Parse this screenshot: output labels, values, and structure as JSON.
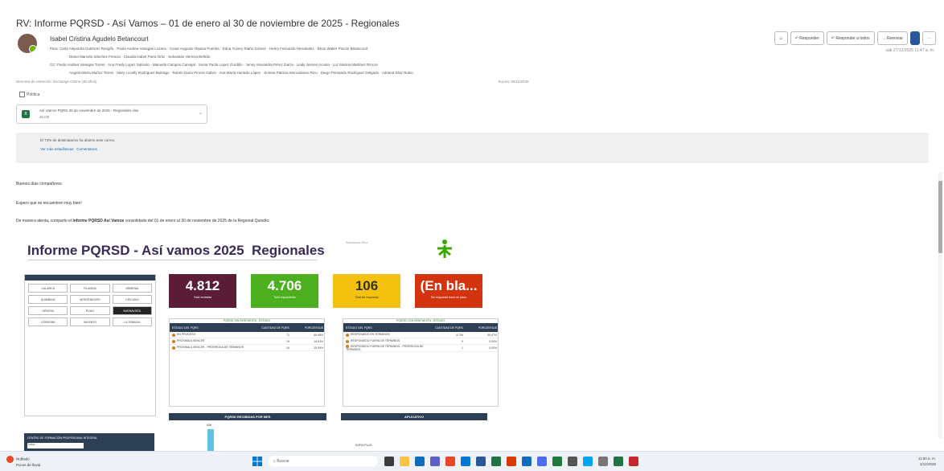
{
  "email": {
    "subject": "RV: Informe PQRSD - Así Vamos – 01 de enero al 30 de noviembre de 2025 - Regionales",
    "sender": "Isabel Cristina Agudelo Betancourt",
    "to_line1": "Para: Carla Alejandra Gutiérrez Rengifo · Paola Andrea Vanegas Lozano · Cesar Augusto Ospina Puertas · Edna Yuvery Riaño Gómez · Henry Fernando Hernández · Brian Walter Pincón Betancourt",
    "to_line2": "Diana Marcela Sánchez Frescia · Claudia Isabel Parra Ortiz · Sebastián Herrera Beltrán",
    "cc_line1": "CC: Paola Andrea Vanegas Torres · Ana Fredy Lopez Salcedo · Manuela Campos Carvajal · Sonia Paola Lopez Gordillo · Jenny Alexandra Pérez Ibarra · Leidy Jeimes Acosta · Luz Marina Martínez Rincon",
    "cc_line2": "Angela María Muñoz Torres · Mary Lucelly Rodríguez Buitrago · Rubén Darío Pinzon Galvis · Ana María Hurtado López · Jimena Patricia Moncaleano Rico · Diego Fernando Rodríguez Delgado · Adriana Díaz Rubio",
    "retention": "Directiva de retención: Exchange Online (30 años)",
    "expires": "Expira: 30/11/2035",
    "date": "sáb 27/12/2025 11:47 a. m.",
    "checkbox_label": "Política",
    "attachment_name": "Así Vamos PQRS 30 de noviembre de 2025 - Regionales.xlsx",
    "attachment_size": "35 KB",
    "info_line": "El 73% de destinatarios ha abierto este correo.",
    "info_link1": "Ver más estadísticas",
    "info_link2": "Comentarios",
    "greeting": "Buenos días compañeros.",
    "wish": "Espero que se encuentren muy bien!",
    "intro": "De manera atenta, comparto el ",
    "intro_bold": "Informe PQRSD Así Vamos",
    "intro_end": " consolidado del 01 de enero al 30 de noviembre de 2025 de la Regional Quindío."
  },
  "toolbar": {
    "emoji": "☺",
    "reply": "↶ Responder",
    "reply_all": "↶ Responder a todos",
    "forward": "→ Reenviar",
    "more": "⋯"
  },
  "report": {
    "title": "Informe PQRSD - Así vamos 2025",
    "title_b": "Regionales",
    "gray_text": "Seleccionar filtros",
    "kpis": [
      {
        "value": "4.812",
        "label": "Total recibidas",
        "color": "#5a1d35"
      },
      {
        "value": "4.706",
        "label": "Total respondidas",
        "color": "#4caf1f"
      },
      {
        "value": "106",
        "label": "Total sin respuesta",
        "color": "#f5c10f"
      },
      {
        "value": "(En bla...",
        "label": "Sin respuesta fuera de plazo",
        "color": "#d4330f"
      }
    ],
    "table1": {
      "caption": "PQRSD SIN RESPUESTA - ESTADO",
      "headers": [
        "ESTADO DEL PQRS",
        "CANTIDAD DE PQRS",
        "PORCENTAJE"
      ],
      "rows": [
        [
          "EN PROCESO",
          "71",
          "66,98%"
        ],
        [
          "PRÓXIMA A VENCER",
          "19",
          "16,51%"
        ],
        [
          "PRÓXIMA A VENCER - PRÓRROGA DE TÉRMINOS",
          "16",
          "15,09%"
        ]
      ]
    },
    "table2": {
      "caption": "PQRSD CON RESPUESTA - ESTADO",
      "headers": [
        "ESTADO DEL PQRS",
        "CANTIDAD DE PQRS",
        "PORCENTAJE"
      ],
      "rows": [
        [
          "RESPONDIDO EN TÉRMINOS",
          "4.706",
          "99,47%"
        ],
        [
          "RESPONDIDO FUERA DE TÉRMINOS",
          "9",
          "0,00%"
        ],
        [
          "RESPONDIDO FUERA DE TÉRMINOS - PRÓRROGA DE TÉRMINOS",
          "1",
          "0,00%"
        ]
      ]
    },
    "chart1_title": "PQRSD RECIBIDAS POR MES",
    "chart1_value": "526",
    "chart2_title": "APLICATIVO",
    "chart2_label": "SOFIA PLUS",
    "filter_title": "CENTRO DE FORMACIÓN PROFESIONAL INTEGRAL",
    "filter_value": "Todos",
    "filters": [
      "CALARCÁ",
      "FILANDIA",
      "ARMENIA",
      "QUIMBAYA",
      "MONTENEGRO",
      "CIRCASIA",
      "GÉNOVA",
      "PIJAO",
      "BUENAVISTA",
      "CÓRDOBA",
      "SALENTO",
      "LA TEBAIDA"
    ]
  },
  "taskbar": {
    "weather": "Nublado",
    "weather_sub": "Pocos de lluvia",
    "search": "Buscar",
    "time": "11:50 a. m.",
    "date": "3/12/2025"
  }
}
